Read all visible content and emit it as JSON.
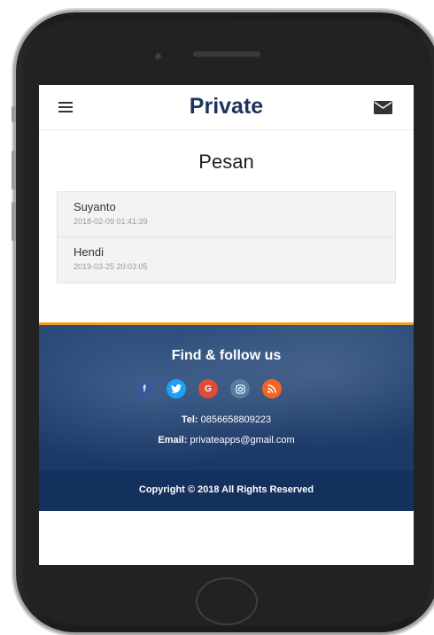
{
  "app": {
    "title": "Private"
  },
  "page": {
    "heading": "Pesan"
  },
  "messages": [
    {
      "name": "Suyanto",
      "timestamp": "2018-02-09 01:41:39"
    },
    {
      "name": "Hendi",
      "timestamp": "2019-03-25 20:03:05"
    }
  ],
  "footer": {
    "follow_title": "Find & follow us",
    "social": [
      {
        "icon": "facebook-icon",
        "glyph": "f",
        "color": "#3b5998"
      },
      {
        "icon": "twitter-icon",
        "glyph": "t",
        "color": "#1da1f2"
      },
      {
        "icon": "google-icon",
        "glyph": "G",
        "color": "#dd4b39"
      },
      {
        "icon": "instagram-icon",
        "glyph": "◎",
        "color": "#517fa4"
      },
      {
        "icon": "rss-icon",
        "glyph": "◠",
        "color": "#f26522"
      }
    ],
    "tel_label": "Tel:",
    "tel_value": "0856658809223",
    "email_label": "Email:",
    "email_value": "privateapps@gmail.com",
    "copyright": "Copyright © 2018 All Rights Reserved"
  },
  "colors": {
    "brand": "#1d3461",
    "accent": "#f0a020",
    "footer_bg": "#1f3d6b"
  }
}
